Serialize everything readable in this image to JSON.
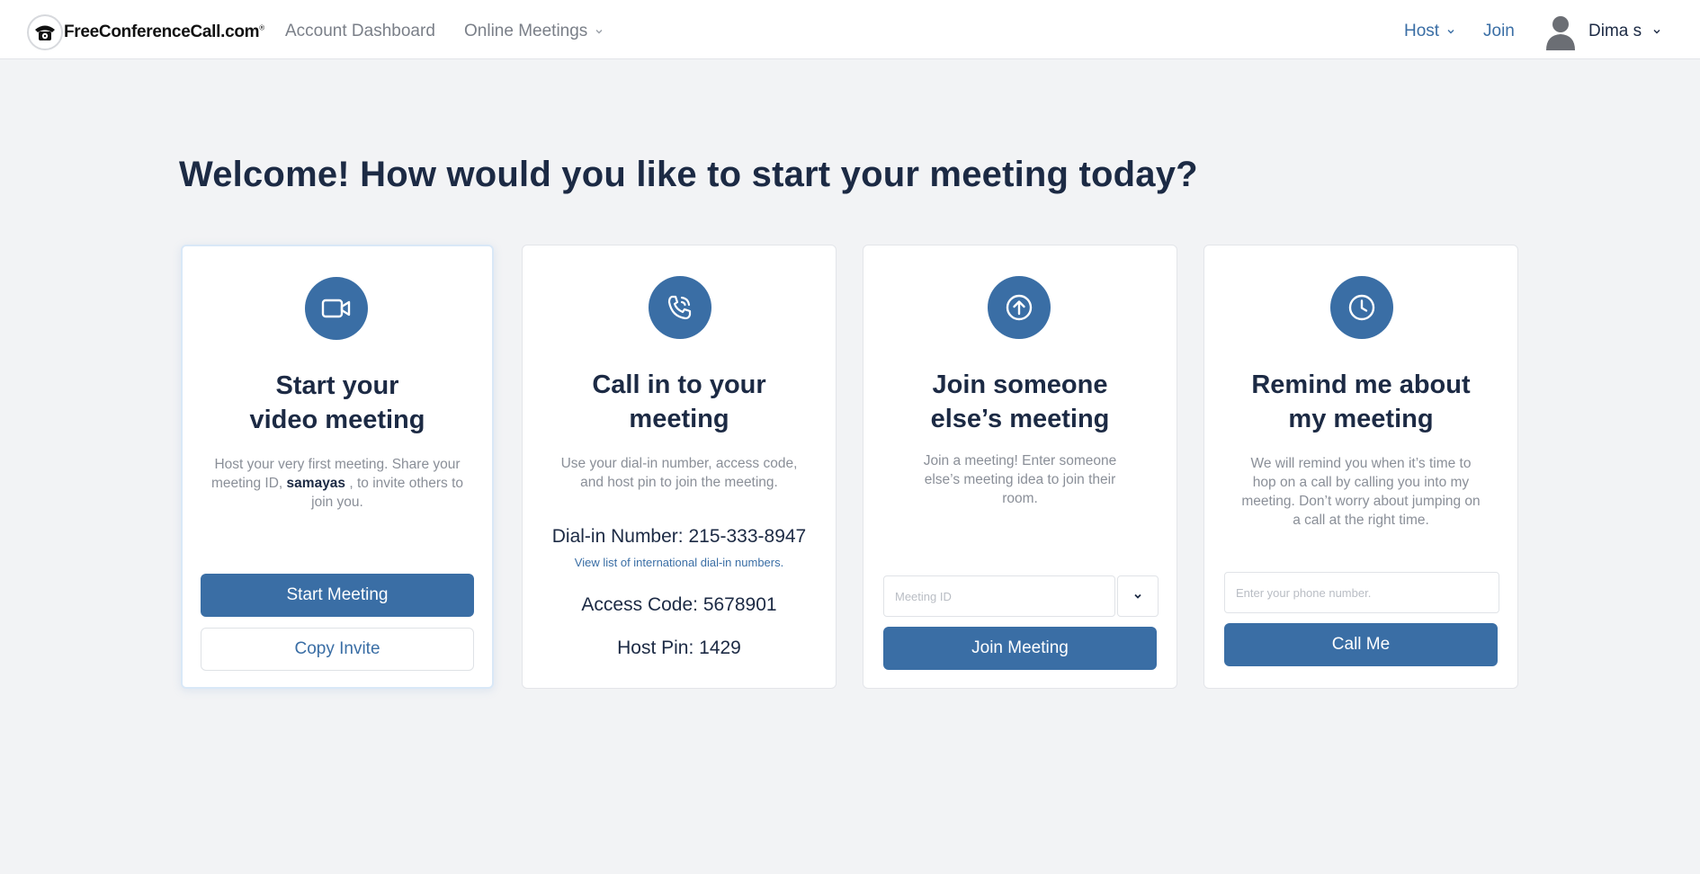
{
  "header": {
    "logo_text": "FreeConferenceCall.com",
    "logo_reg": "®",
    "nav": {
      "account_dashboard": "Account Dashboard",
      "online_meetings": "Online Meetings"
    },
    "host_label": "Host",
    "join_label": "Join",
    "user_name": "Dima s"
  },
  "page_title": "Welcome! How would you like to start your meeting today?",
  "cards": [
    {
      "icon": "video-camera-icon",
      "title_line1": "Start your",
      "title_line2": "video meeting",
      "desc_before": "Host your very first meeting. Share your meeting ID,",
      "desc_bold": "samayas",
      "desc_after": ", to invite others to join you.",
      "primary_button": "Start Meeting",
      "secondary_button": "Copy Invite"
    },
    {
      "icon": "phone-call-icon",
      "title_line1": "Call in to your",
      "title_line2": "meeting",
      "desc": "Use your dial-in number, access code, and host pin to join the meeting.",
      "dial_in": "Dial-in Number: 215-333-8947",
      "intl_link": "View list of international dial-in numbers.",
      "access_code": "Access Code: 5678901",
      "host_pin": "Host Pin: 1429"
    },
    {
      "icon": "arrow-up-circle-icon",
      "title_line1": "Join someone",
      "title_line2": "else’s meeting",
      "desc": "Join a meeting! Enter someone else’s meeting idea to join their room.",
      "input_placeholder": "Meeting ID",
      "primary_button": "Join Meeting"
    },
    {
      "icon": "clock-icon",
      "title_line1": "Remind me about",
      "title_line2": "my meeting",
      "desc": "We will remind you when it’s time to hop on a call by calling you into my meeting. Don’t worry about jumping on a call at the right time.",
      "input_placeholder": "Enter your phone number.",
      "primary_button": "Call Me"
    }
  ],
  "colors": {
    "accent": "#3a6ea5",
    "heading": "#1c2a44",
    "muted": "#8a8f98",
    "background": "#f2f3f5"
  }
}
